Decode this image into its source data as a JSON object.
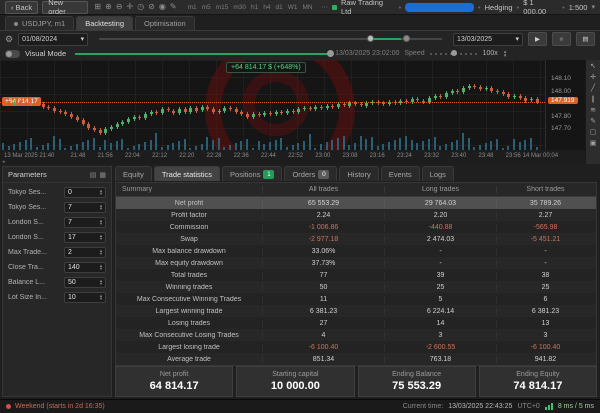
{
  "toolbar": {
    "back_label": "Back",
    "new_order_label": "New order",
    "icons": [
      {
        "name": "layout-icon",
        "glyph": "⊞"
      },
      {
        "name": "zoom-in-icon",
        "glyph": "⊕"
      },
      {
        "name": "zoom-out-icon",
        "glyph": "⊖"
      },
      {
        "name": "crosshair-icon",
        "glyph": "✛"
      },
      {
        "name": "clock-icon",
        "glyph": "◷"
      },
      {
        "name": "disable-icon",
        "glyph": "⊘"
      },
      {
        "name": "eye-icon",
        "glyph": "◉"
      },
      {
        "name": "edit-chart-icon",
        "glyph": "✎"
      }
    ],
    "timeframes": [
      "m1",
      "m5",
      "m15",
      "m30",
      "h1",
      "h4",
      "d1",
      "W1",
      "MN"
    ],
    "overflow": "⋯",
    "account": {
      "broker": "Raw Trading Ltd",
      "mode": "Hedging",
      "balance": "$ 1 000.00",
      "leverage": "1:500"
    }
  },
  "tabs": {
    "symbol": "USDJPY, m1",
    "backtesting": "Backtesting",
    "optimisation": "Optimisation"
  },
  "controls": {
    "start_date": "01/08/2024",
    "end_date": "13/03/2025",
    "play": "▶",
    "stop": "■",
    "journal": "▤",
    "visual_mode_label": "Visual Mode",
    "current_datetime": "13/03/2025 23:02:00",
    "speed_label": "Speed",
    "speed_value": "100x"
  },
  "chart": {
    "tooltip": "+64 814.17 $ (+648%)",
    "left_badge": "+64 814.17",
    "current_price": "147.919",
    "axis": {
      "min": 147.58,
      "max": 148.24,
      "labels": [
        "148.10",
        "148.00",
        "147.80",
        "147.70"
      ]
    },
    "time_labels": [
      "13 Mar 2025 21:40",
      "21:48",
      "21:56",
      "22:04",
      "22:12",
      "22:20",
      "22:28",
      "22:36",
      "22:44",
      "22:52",
      "23:00",
      "23:08",
      "23:16",
      "23:24",
      "23:32",
      "23:40",
      "23:48",
      "23:56",
      "14 Mar 00:04"
    ],
    "closes": [
      147.91,
      147.9,
      147.92,
      147.91,
      147.9,
      147.91,
      147.9,
      147.88,
      147.87,
      147.85,
      147.84,
      147.82,
      147.8,
      147.77,
      147.74,
      147.71,
      147.69,
      147.67,
      147.7,
      147.72,
      147.74,
      147.76,
      147.78,
      147.8,
      147.79,
      147.82,
      147.84,
      147.83,
      147.86,
      147.85,
      147.83,
      147.86,
      147.84,
      147.87,
      147.85,
      147.88,
      147.86,
      147.84,
      147.85,
      147.87,
      147.86,
      147.84,
      147.82,
      147.8,
      147.82,
      147.81,
      147.83,
      147.82,
      147.84,
      147.83,
      147.85,
      147.84,
      147.86,
      147.87,
      147.86,
      147.88,
      147.87,
      147.89,
      147.88,
      147.9,
      147.89,
      147.91,
      147.9,
      147.89,
      147.91,
      147.92,
      147.91,
      147.9,
      147.92,
      147.91,
      147.93,
      147.92,
      147.94,
      147.93,
      147.92,
      147.95,
      147.97,
      147.96,
      147.99,
      148.01,
      148.0,
      148.03,
      148.05,
      148.04,
      148.02,
      148.03,
      148.01,
      148.0,
      147.98,
      147.96,
      147.97,
      147.95,
      147.93,
      147.94,
      147.92
    ],
    "tools": [
      {
        "name": "pointer-icon",
        "glyph": "↖"
      },
      {
        "name": "crosshair-icon",
        "glyph": "✛"
      },
      {
        "name": "trendline-icon",
        "glyph": "╱"
      },
      {
        "name": "channel-icon",
        "glyph": "∥"
      },
      {
        "name": "fibonacci-icon",
        "glyph": "≋"
      },
      {
        "name": "draw-icon",
        "glyph": "✎"
      },
      {
        "name": "shapes-icon",
        "glyph": "▢"
      },
      {
        "name": "comment-icon",
        "glyph": "▣"
      }
    ],
    "colors": {
      "up": "#53b06a",
      "down": "#c6603f",
      "accent": "#d8622a",
      "volume": "#2e6b85"
    }
  },
  "params": {
    "title": "Parameters",
    "rows": [
      {
        "label": "Tokyo Ses...",
        "value": "0"
      },
      {
        "label": "Tokyo Ses...",
        "value": "7"
      },
      {
        "label": "London S...",
        "value": "7"
      },
      {
        "label": "London S...",
        "value": "17"
      },
      {
        "label": "Max Trade...",
        "value": "2"
      },
      {
        "label": "Close Tra...",
        "value": "140"
      },
      {
        "label": "Balance L...",
        "value": "50"
      },
      {
        "label": "Lot Size In...",
        "value": "10"
      }
    ]
  },
  "subtabs": [
    {
      "label": "Equity"
    },
    {
      "label": "Trade statistics",
      "active": true
    },
    {
      "label": "Positions",
      "badge": "1",
      "badge_color": "#1f9e5a"
    },
    {
      "label": "Orders",
      "badge": "0",
      "badge_color": "#5a5a5a"
    },
    {
      "label": "History"
    },
    {
      "label": "Events"
    },
    {
      "label": "Logs"
    }
  ],
  "table": {
    "headers": [
      "Summary",
      "All trades",
      "Long trades",
      "Short trades"
    ],
    "rows": [
      {
        "label": "Net profit",
        "all": "65 553.29",
        "long": "29 764.03",
        "short": "35 789.26",
        "selected": true
      },
      {
        "label": "Profit factor",
        "all": "2.24",
        "long": "2.20",
        "short": "2.27"
      },
      {
        "label": "Commission",
        "all": "-1 006.86",
        "long": "-440.88",
        "short": "-565.98"
      },
      {
        "label": "Swap",
        "all": "-2 977.18",
        "long": "2 474.03",
        "short": "-5 451.21"
      },
      {
        "label": "Max balance drawdown",
        "all": "33.06%",
        "long": "-",
        "short": "-"
      },
      {
        "label": "Max equity drawdown",
        "all": "37.73%",
        "long": "-",
        "short": "-"
      },
      {
        "label": "Total trades",
        "all": "77",
        "long": "39",
        "short": "38"
      },
      {
        "label": "Winning trades",
        "all": "50",
        "long": "25",
        "short": "25"
      },
      {
        "label": "Max Consecutive Winning Trades",
        "all": "11",
        "long": "5",
        "short": "6"
      },
      {
        "label": "Largest winning trade",
        "all": "6 381.23",
        "long": "6 224.14",
        "short": "6 381.23"
      },
      {
        "label": "Losing trades",
        "all": "27",
        "long": "14",
        "short": "13"
      },
      {
        "label": "Max Consecutive Losing Trades",
        "all": "4",
        "long": "3",
        "short": "3"
      },
      {
        "label": "Largest losing trade",
        "all": "-6 100.40",
        "long": "-2 600.55",
        "short": "-6 100.40"
      },
      {
        "label": "Average trade",
        "all": "851.34",
        "long": "763.18",
        "short": "941.82"
      }
    ]
  },
  "summary_cards": [
    {
      "label": "Net profit",
      "value": "64 814.17"
    },
    {
      "label": "Starting capital",
      "value": "10 000.00"
    },
    {
      "label": "Ending Balance",
      "value": "75 553.29"
    },
    {
      "label": "Ending Equity",
      "value": "74 814.17"
    }
  ],
  "statusbar": {
    "left": "Weekend (starts in 2d 16:35)",
    "current_time_label": "Current time:",
    "current_time": "13/03/2025 22:43:25",
    "timezone": "UTC+0",
    "latency": "8 ms / 5 ms"
  }
}
